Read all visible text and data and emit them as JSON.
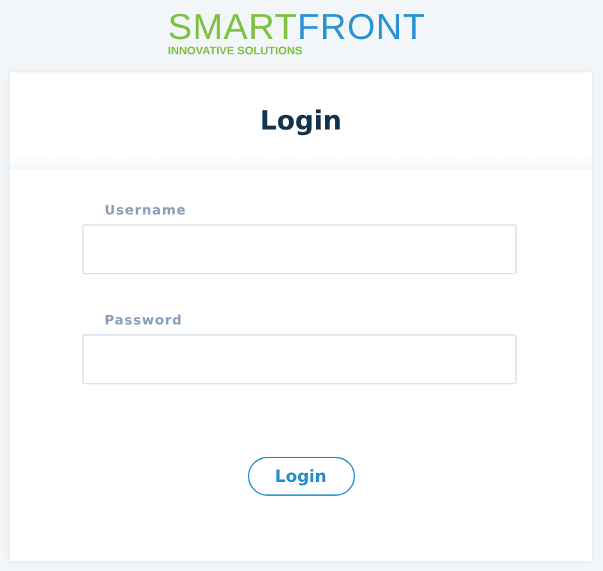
{
  "logo": {
    "primary": "SMART",
    "secondary": "FRONT",
    "tagline": "INNOVATIVE SOLUTIONS"
  },
  "title": "Login",
  "fields": [
    {
      "label": "Username"
    },
    {
      "label": "Password"
    }
  ],
  "button": "Login"
}
